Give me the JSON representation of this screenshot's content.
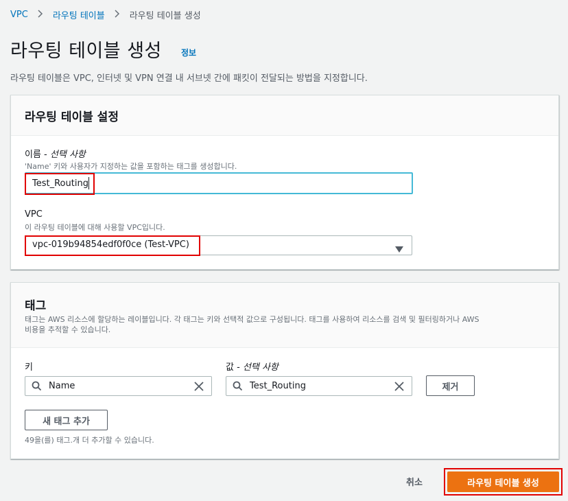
{
  "breadcrumb": {
    "items": [
      "VPC",
      "라우팅 테이블",
      "라우팅 테이블 생성"
    ],
    "separator": ">"
  },
  "header": {
    "title": "라우팅 테이블 생성",
    "info_link": "정보",
    "description": "라우팅 테이블은 VPC, 인터넷 및 VPN 연결 내 서브넷 간에 패킷이 전달되는 방법을 지정합니다."
  },
  "settings_panel": {
    "title": "라우팅 테이블 설정",
    "name_field": {
      "label": "이름 - ",
      "label_optional": "선택 사항",
      "help": "'Name' 키와 사용자가 지정하는 값을 포함하는 태그를 생성합니다.",
      "value": "Test_Routing"
    },
    "vpc_field": {
      "label": "VPC",
      "help": "이 라우팅 테이블에 대해 사용할 VPC입니다.",
      "selected": "vpc-019b94854edf0f0ce (Test-VPC)",
      "dropdown_icon": "caret-down-icon"
    }
  },
  "tags_panel": {
    "title": "태그",
    "description_line1": "태그는 AWS 리소스에 할당하는 레이블입니다. 각 태그는 키와 선택적 값으로 구성됩니다. 태그를 사용하여 리소스를 검색 및 필터링하거나 AWS",
    "description_line2": "비용을 추적할 수 있습니다.",
    "key_label": "키",
    "value_label": "값 - ",
    "value_label_optional": "선택 사항",
    "tag_row": {
      "key": "Name",
      "value": "Test_Routing",
      "search_icon": "search-icon",
      "clear_icon": "close-icon",
      "remove_label": "제거"
    },
    "add_tag_label": "새 태그 추가",
    "remaining_note": "49을(를) 태그.개 더 추가할 수 있습니다."
  },
  "footer": {
    "cancel_label": "취소",
    "submit_label": "라우팅 테이블 생성"
  },
  "colors": {
    "accent_orange": "#ec7211",
    "link_blue": "#0073bb",
    "highlight_red": "#e10000",
    "focus_cyan": "#44b9d6",
    "background": "#f2f3f3"
  }
}
